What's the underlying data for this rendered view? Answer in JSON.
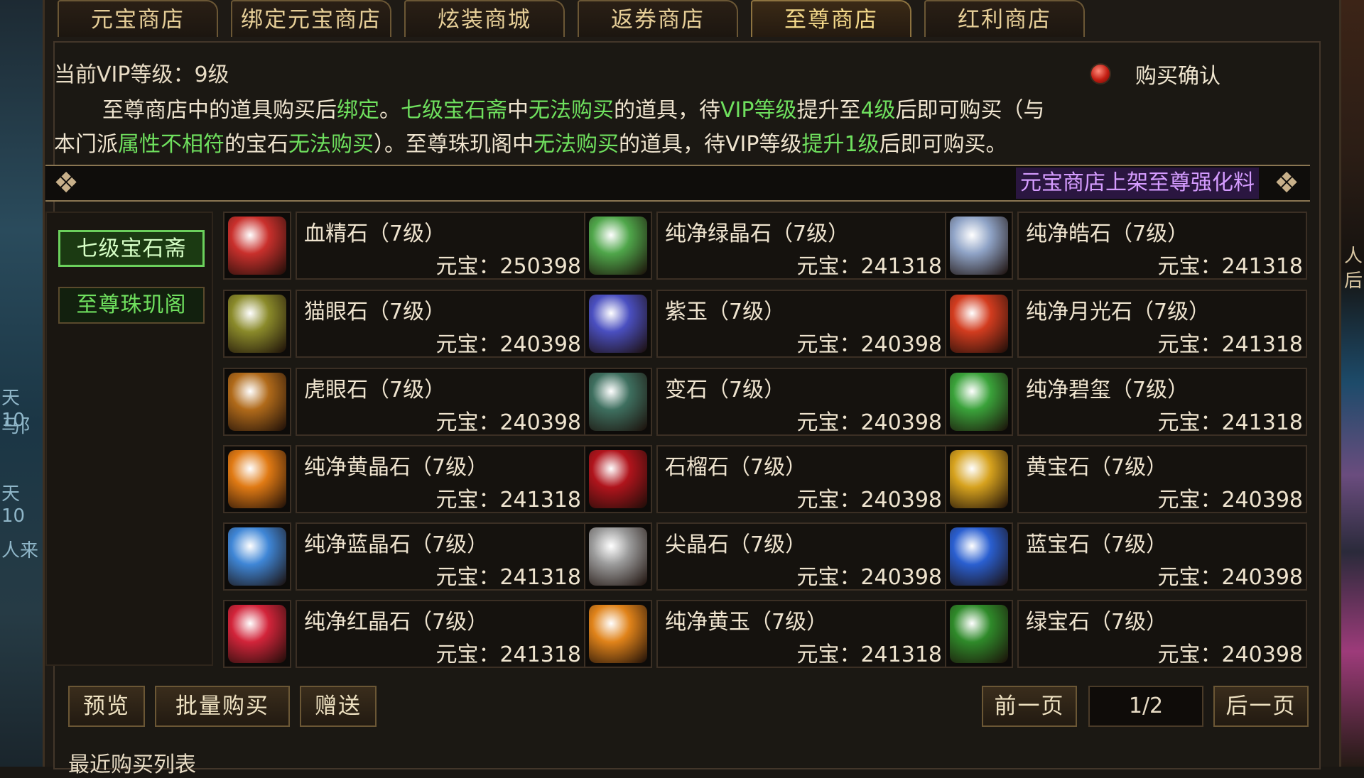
{
  "tabs": [
    {
      "label": "元宝商店"
    },
    {
      "label": "绑定元宝商店"
    },
    {
      "label": "炫装商城"
    },
    {
      "label": "返券商店"
    },
    {
      "label": "至尊商店"
    },
    {
      "label": "红利商店"
    }
  ],
  "active_tab": "至尊商店",
  "vip": {
    "label": "当前VIP等级：",
    "value": "9级"
  },
  "purchase_confirm_label": "购买确认",
  "notice": {
    "line1": [
      {
        "text": "至尊商店中的道具购买后",
        "color": "white"
      },
      {
        "text": "绑定",
        "color": "green"
      },
      {
        "text": "。",
        "color": "white"
      },
      {
        "text": "七级宝石斋",
        "color": "green"
      },
      {
        "text": "中",
        "color": "white"
      },
      {
        "text": "无法购买",
        "color": "green"
      },
      {
        "text": "的道具，待",
        "color": "white"
      },
      {
        "text": "VIP等级",
        "color": "green"
      },
      {
        "text": "提升至",
        "color": "white"
      },
      {
        "text": "4级",
        "color": "green"
      },
      {
        "text": "后即可购买（与",
        "color": "white"
      }
    ],
    "line2": [
      {
        "text": "本门派",
        "color": "white"
      },
      {
        "text": "属性不相符",
        "color": "green"
      },
      {
        "text": "的宝石",
        "color": "white"
      },
      {
        "text": "无法购买",
        "color": "green"
      },
      {
        "text": "）。至尊珠玑阁中",
        "color": "white"
      },
      {
        "text": "无法购买",
        "color": "green"
      },
      {
        "text": "的道具，待VIP等级",
        "color": "white"
      },
      {
        "text": "提升1级",
        "color": "green"
      },
      {
        "text": "后即可购买。",
        "color": "white"
      }
    ]
  },
  "marquee": "元宝商店上架至尊强化料",
  "sidebar": {
    "items": [
      {
        "label": "七级宝石斋",
        "active": true
      },
      {
        "label": "至尊珠玑阁",
        "active": false
      }
    ]
  },
  "price_label": "元宝：",
  "items": [
    {
      "name": "血精石（7级）",
      "price": "250398",
      "icon": "blood-gem-icon",
      "color": "#c9302c"
    },
    {
      "name": "纯净绿晶石（7级）",
      "price": "241318",
      "icon": "green-crystal-icon",
      "color": "#4fa64a"
    },
    {
      "name": "纯净皓石（7级）",
      "price": "241318",
      "icon": "white-gem-icon",
      "color": "#8fa3c6"
    },
    {
      "name": "猫眼石（7级）",
      "price": "240398",
      "icon": "cat-eye-icon",
      "color": "#8a8a2a"
    },
    {
      "name": "紫玉（7级）",
      "price": "240398",
      "icon": "purple-jade-icon",
      "color": "#4a4fc0"
    },
    {
      "name": "纯净月光石（7级）",
      "price": "241318",
      "icon": "moonstone-icon",
      "color": "#d23c1f"
    },
    {
      "name": "虎眼石（7级）",
      "price": "240398",
      "icon": "tiger-eye-icon",
      "color": "#b06a1a"
    },
    {
      "name": "变石（7级）",
      "price": "240398",
      "icon": "alexandrite-icon",
      "color": "#3e6f5f"
    },
    {
      "name": "纯净碧玺（7级）",
      "price": "241318",
      "icon": "tourmaline-icon",
      "color": "#3aa23a"
    },
    {
      "name": "纯净黄晶石（7级）",
      "price": "241318",
      "icon": "citrine-icon",
      "color": "#e07a14"
    },
    {
      "name": "石榴石（7级）",
      "price": "240398",
      "icon": "garnet-icon",
      "color": "#b0141c"
    },
    {
      "name": "黄宝石（7级）",
      "price": "240398",
      "icon": "topaz-icon",
      "color": "#d6a21e"
    },
    {
      "name": "纯净蓝晶石（7级）",
      "price": "241318",
      "icon": "blue-crystal-icon",
      "color": "#3f86d6"
    },
    {
      "name": "尖晶石（7级）",
      "price": "240398",
      "icon": "spinel-icon",
      "color": "#9a9a9a"
    },
    {
      "name": "蓝宝石（7级）",
      "price": "240398",
      "icon": "sapphire-icon",
      "color": "#2a5fd0"
    },
    {
      "name": "纯净红晶石（7级）",
      "price": "241318",
      "icon": "red-crystal-icon",
      "color": "#d2243a"
    },
    {
      "name": "纯净黄玉（7级）",
      "price": "241318",
      "icon": "yellow-jade-icon",
      "color": "#e0831a"
    },
    {
      "name": "绿宝石（7级）",
      "price": "240398",
      "icon": "emerald-icon",
      "color": "#2f8a2a"
    }
  ],
  "buttons": {
    "preview": "预览",
    "bulk_buy": "批量购买",
    "gift": "赠送",
    "prev_page": "前一页",
    "next_page": "后一页"
  },
  "pagination": {
    "current": 1,
    "total": 2,
    "text": "1/2"
  },
  "recent_purchases_label": "最近购买列表",
  "background": {
    "left_fragments": [
      "天10",
      "马阝",
      "天10",
      "人来"
    ],
    "right_fragments": [
      "人",
      "后"
    ]
  },
  "colors": {
    "highlight_green": "#6fe05e",
    "marquee_purple": "#d59cff",
    "panel_bg": "#1e1a15",
    "border_gold": "#6b5735"
  }
}
